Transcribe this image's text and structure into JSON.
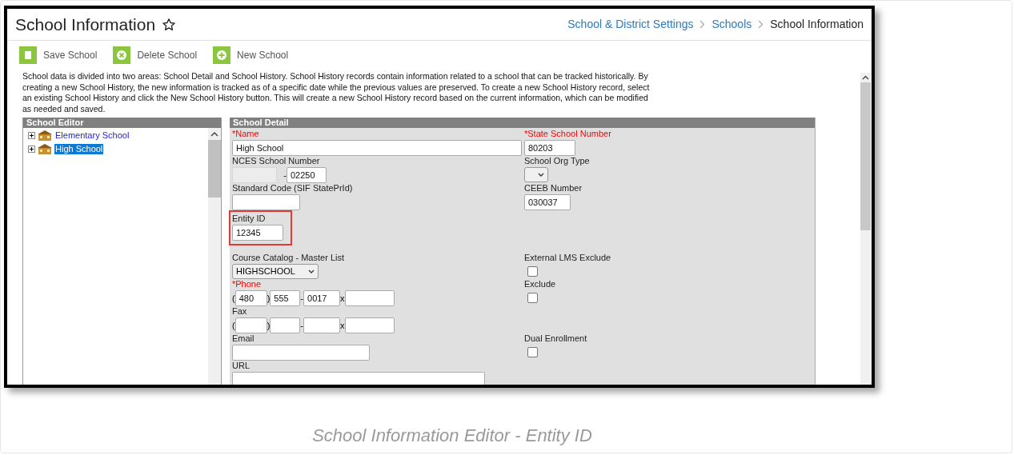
{
  "header": {
    "title": "School Information",
    "breadcrumbs": [
      {
        "label": "School & District Settings",
        "current": false
      },
      {
        "label": "Schools",
        "current": false
      },
      {
        "label": "School Information",
        "current": true
      }
    ]
  },
  "toolbar": [
    {
      "kind": "save",
      "label": "Save School"
    },
    {
      "kind": "delete",
      "label": "Delete School"
    },
    {
      "kind": "new",
      "label": "New School"
    }
  ],
  "description": "School data is divided into two areas: School Detail and School History. School History records contain information related to a school that can be tracked historically. By creating a new School History, the new information is tracked as of a specific date while the previous values are preserved. To create a new School History record, select an existing School History and click the New School History button. This will create a new School History record based on the current information, which can be modified as needed and saved.",
  "editor": {
    "title": "School Editor",
    "items": [
      {
        "label": "Elementary School",
        "expanded": false,
        "selected": false
      },
      {
        "label": "High School",
        "expanded": false,
        "selected": true
      }
    ]
  },
  "detail": {
    "title": "School Detail",
    "rows": [
      {
        "left": {
          "kind": "text",
          "label": "*Name",
          "required": true,
          "value": "High School"
        },
        "right": {
          "kind": "text",
          "label": "*State School Number",
          "required": true,
          "value": "80203"
        }
      },
      {
        "left": {
          "kind": "nces",
          "label": "NCES School Number",
          "separator": "-",
          "value": "02250"
        },
        "right": {
          "kind": "select",
          "label": "School Org Type",
          "required": false
        }
      },
      {
        "left": {
          "kind": "text",
          "label": "Standard Code (SIF StatePrId)",
          "required": false
        },
        "right": {
          "kind": "text",
          "label": "CEEB Number",
          "required": false,
          "value": "030037"
        }
      },
      {
        "left": {
          "kind": "text",
          "label": "Entity ID",
          "required": false,
          "value": "12345",
          "highlighted": true
        }
      },
      {
        "left": {
          "kind": "select",
          "label": "Course Catalog - Master List",
          "required": false,
          "value": "HIGHSCHOOL"
        },
        "right": {
          "kind": "checkbox",
          "label": "External LMS Exclude",
          "checked": false
        }
      },
      {
        "left": {
          "kind": "phone",
          "label": "*Phone",
          "required": true,
          "separators": [
            "(",
            ")",
            "-",
            "x"
          ],
          "parts": [
            "480",
            "555",
            "0017"
          ]
        },
        "right": {
          "kind": "checkbox",
          "label": "Exclude",
          "checked": false
        }
      },
      {
        "left": {
          "kind": "phone",
          "label": "Fax",
          "required": false,
          "separators": [
            "(",
            ")",
            "-",
            "x"
          ]
        }
      },
      {
        "left": {
          "kind": "text",
          "label": "Email",
          "required": false
        },
        "right": {
          "kind": "checkbox",
          "label": "Dual Enrollment",
          "checked": false
        }
      },
      {
        "left": {
          "kind": "textarea",
          "label": "URL",
          "required": false
        }
      }
    ]
  },
  "caption": "School Information Editor - Entity ID"
}
